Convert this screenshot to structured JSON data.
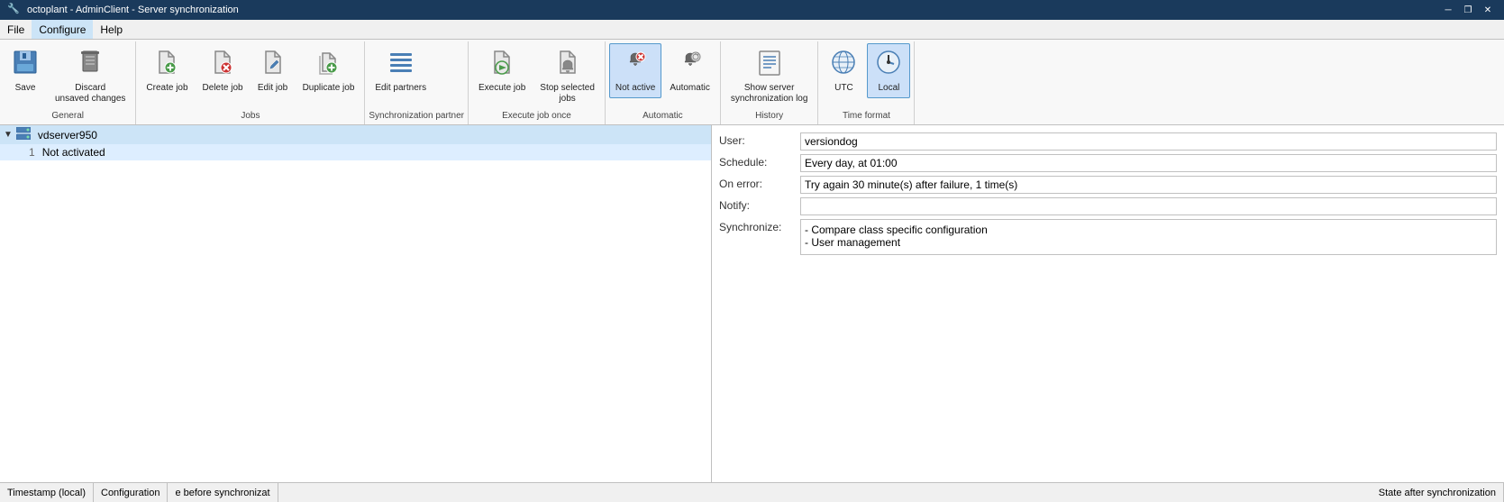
{
  "titleBar": {
    "title": "octoplant - AdminClient - Server synchronization",
    "icon": "🔧",
    "controls": {
      "minimize": "─",
      "restore": "❐",
      "close": "✕"
    }
  },
  "menuBar": {
    "items": [
      "File",
      "Configure",
      "Help"
    ],
    "active": "Configure"
  },
  "ribbon": {
    "groups": [
      {
        "label": "General",
        "buttons": [
          {
            "id": "save",
            "label": "Save",
            "icon": "💾"
          },
          {
            "id": "discard",
            "label": "Discard\nunsaved changes",
            "icon": "🗑️"
          }
        ]
      },
      {
        "label": "Jobs",
        "buttons": [
          {
            "id": "create-job",
            "label": "Create job",
            "icon": "📋"
          },
          {
            "id": "delete-job",
            "label": "Delete job",
            "icon": "🗑️"
          },
          {
            "id": "edit-job",
            "label": "Edit job",
            "icon": "✏️"
          },
          {
            "id": "duplicate-job",
            "label": "Duplicate job",
            "icon": "📋"
          }
        ]
      },
      {
        "label": "Synchronization partner",
        "buttons": [
          {
            "id": "edit-partners",
            "label": "Edit partners",
            "icon": "☰"
          }
        ]
      },
      {
        "label": "Execute job once",
        "buttons": [
          {
            "id": "execute-job",
            "label": "Execute job",
            "icon": "▶"
          },
          {
            "id": "stop-jobs",
            "label": "Stop selected\njobs",
            "icon": "🔔"
          }
        ]
      },
      {
        "label": "Automatic",
        "buttons": [
          {
            "id": "not-active",
            "label": "Not active",
            "icon": "🔔",
            "active": true
          },
          {
            "id": "automatic",
            "label": "Automatic",
            "icon": "⏰"
          }
        ]
      },
      {
        "label": "History",
        "buttons": [
          {
            "id": "show-log",
            "label": "Show server\nsynchronization log",
            "icon": "📄"
          }
        ]
      },
      {
        "label": "Time format",
        "buttons": [
          {
            "id": "utc",
            "label": "UTC",
            "icon": "🌐"
          },
          {
            "id": "local",
            "label": "Local",
            "icon": "🕐",
            "active": true
          }
        ]
      }
    ]
  },
  "leftPanel": {
    "treeItems": [
      {
        "id": "vdserver950",
        "label": "vdserver950",
        "expanded": true,
        "children": [
          {
            "id": "row1",
            "number": "1",
            "status": "Not activated"
          }
        ]
      }
    ]
  },
  "rightPanel": {
    "fields": [
      {
        "label": "User:",
        "value": "versiondog",
        "id": "user"
      },
      {
        "label": "Schedule:",
        "value": "Every day, at 01:00",
        "id": "schedule"
      },
      {
        "label": "On error:",
        "value": "Try again 30 minute(s) after failure, 1 time(s)",
        "id": "on-error"
      },
      {
        "label": "Notify:",
        "value": "",
        "id": "notify"
      },
      {
        "label": "Synchronize:",
        "value": "- Compare class specific configuration\n- User management",
        "id": "synchronize",
        "multi": true
      }
    ]
  },
  "statusBar": {
    "columns": [
      {
        "id": "timestamp",
        "label": "Timestamp (local)"
      },
      {
        "id": "configuration",
        "label": "Configuration"
      },
      {
        "id": "state-before",
        "label": "e before synchronizat"
      },
      {
        "id": "state-after",
        "label": "State after synchronization"
      }
    ]
  }
}
